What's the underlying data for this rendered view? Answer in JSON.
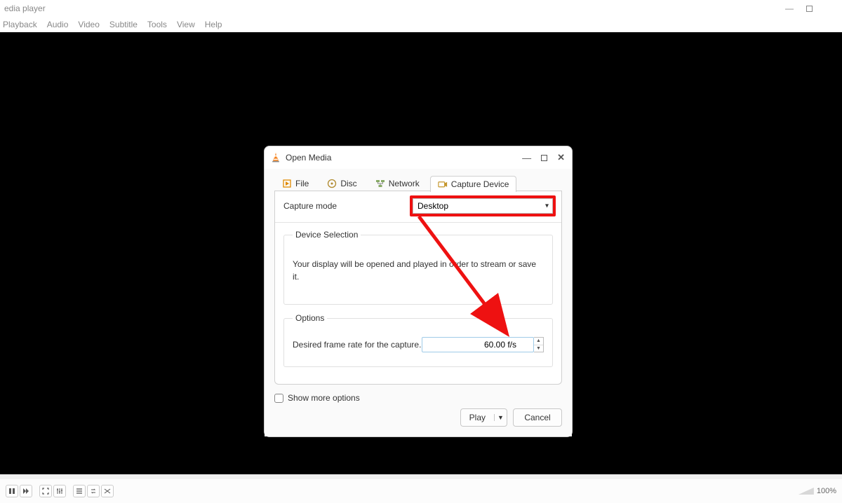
{
  "window": {
    "title": "edia player",
    "menus": [
      "Playback",
      "Audio",
      "Video",
      "Subtitle",
      "Tools",
      "View",
      "Help"
    ],
    "volume_pct": "100%"
  },
  "dialog": {
    "title": "Open Media",
    "tabs": {
      "file": "File",
      "disc": "Disc",
      "network": "Network",
      "capture": "Capture Device"
    },
    "capture": {
      "mode_label": "Capture mode",
      "mode_value": "Desktop",
      "device_group_title": "Device Selection",
      "device_msg": "Your display will be opened and played in order to stream or save it.",
      "options_group_title": "Options",
      "fps_label": "Desired frame rate for the capture.",
      "fps_value": "60.00 f/s"
    },
    "show_more": "Show more options",
    "play": "Play",
    "cancel": "Cancel"
  }
}
